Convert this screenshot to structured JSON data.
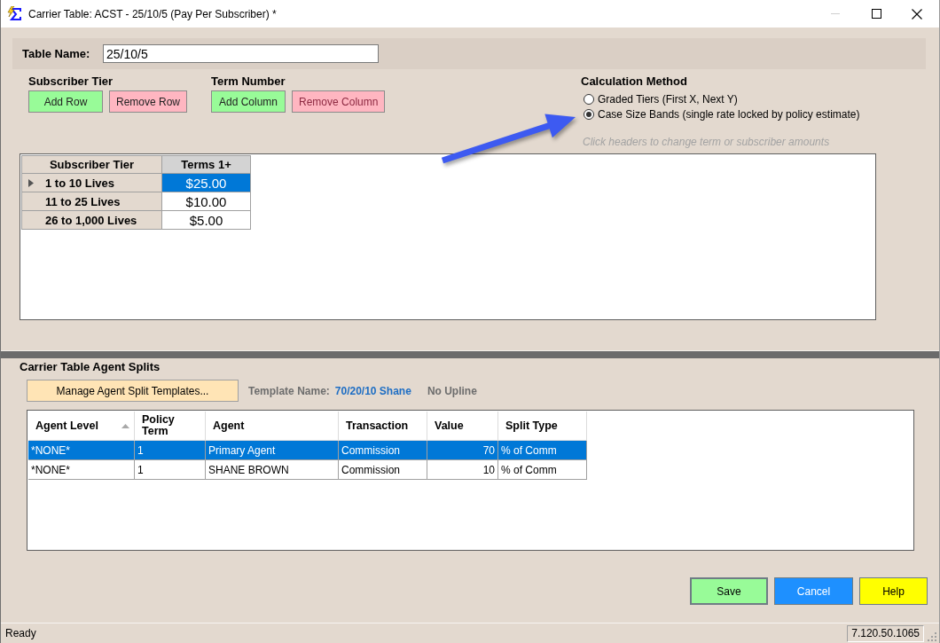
{
  "window": {
    "title": "Carrier Table: ACST - 25/10/5 (Pay Per Subscriber) *",
    "minimize": {
      "disabled": true
    }
  },
  "table_name": {
    "label": "Table Name:",
    "value": "25/10/5"
  },
  "button_groups": [
    {
      "label": "Subscriber Tier",
      "buttons": [
        {
          "label": "Add Row",
          "kind": "add",
          "disabled": false
        },
        {
          "label": "Remove Row",
          "kind": "remove",
          "disabled": false
        }
      ]
    },
    {
      "label": "Term Number",
      "buttons": [
        {
          "label": "Add Column",
          "kind": "add",
          "disabled": false
        },
        {
          "label": "Remove Column",
          "kind": "remove",
          "disabled": true
        }
      ]
    }
  ],
  "calculation_method": {
    "label": "Calculation Method",
    "options": [
      {
        "label": "Graded Tiers (First X, Next Y)",
        "selected": false
      },
      {
        "label": "Case Size Bands (single rate locked by policy estimate)",
        "selected": true
      }
    ],
    "hint": "Click headers to change term or subscriber amounts"
  },
  "tier_grid": {
    "columns": [
      "Subscriber Tier",
      "Terms 1+"
    ],
    "rows": [
      {
        "tier": "1 to 10 Lives",
        "amount": "$25.00",
        "selected": true
      },
      {
        "tier": "11 to 25 Lives",
        "amount": "$10.00",
        "selected": false
      },
      {
        "tier": "26 to 1,000 Lives",
        "amount": "$5.00",
        "selected": false
      }
    ]
  },
  "agent_splits": {
    "title": "Carrier Table Agent Splits",
    "manage_button": "Manage Agent Split Templates...",
    "template_label": "Template Name:",
    "template_name": "70/20/10 Shane",
    "upline": "No Upline",
    "columns": [
      {
        "label": "Agent Level",
        "sorted": true
      },
      {
        "label": "Policy Term",
        "sorted": false
      },
      {
        "label": "Agent",
        "sorted": false
      },
      {
        "label": "Transaction",
        "sorted": false
      },
      {
        "label": "Value",
        "sorted": false
      },
      {
        "label": "Split Type",
        "sorted": false
      }
    ],
    "rows": [
      {
        "cells": [
          "*NONE*",
          "1",
          "Primary Agent",
          "Commission",
          "70",
          "% of Comm"
        ],
        "selected": true
      },
      {
        "cells": [
          "*NONE*",
          "1",
          "SHANE BROWN",
          "Commission",
          "10",
          "% of Comm"
        ],
        "selected": false
      }
    ]
  },
  "buttons": [
    {
      "label": "Save",
      "kind": "save"
    },
    {
      "label": "Cancel",
      "kind": "cancel"
    },
    {
      "label": "Help",
      "kind": "help"
    }
  ],
  "status_bar": {
    "text": "Ready",
    "version": "7.120.50.1065"
  }
}
